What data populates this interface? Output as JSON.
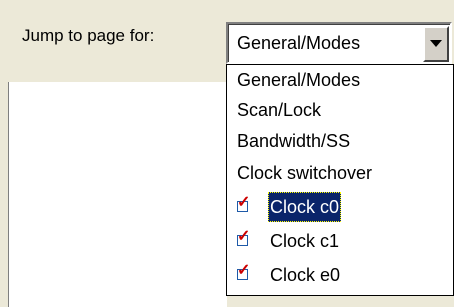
{
  "header": {
    "label": "Jump to page for:"
  },
  "combo": {
    "value": "General/Modes"
  },
  "dropdown": {
    "options": [
      {
        "label": "General/Modes",
        "checked": false
      },
      {
        "label": "Scan/Lock",
        "checked": false
      },
      {
        "label": "Bandwidth/SS",
        "checked": false
      },
      {
        "label": "Clock switchover",
        "checked": false
      },
      {
        "label": "Clock c0",
        "checked": true,
        "selected": true
      },
      {
        "label": "Clock c1",
        "checked": true
      },
      {
        "label": "Clock e0",
        "checked": true
      }
    ]
  },
  "colors": {
    "window_bg": "#ece9d8",
    "selection_bg": "#0a246a",
    "selection_fg": "#ffffff",
    "checkmark": "#cc0000"
  },
  "icons": {
    "combo_arrow": "chevron-down-icon",
    "check": "checkbox-checked-icon"
  }
}
